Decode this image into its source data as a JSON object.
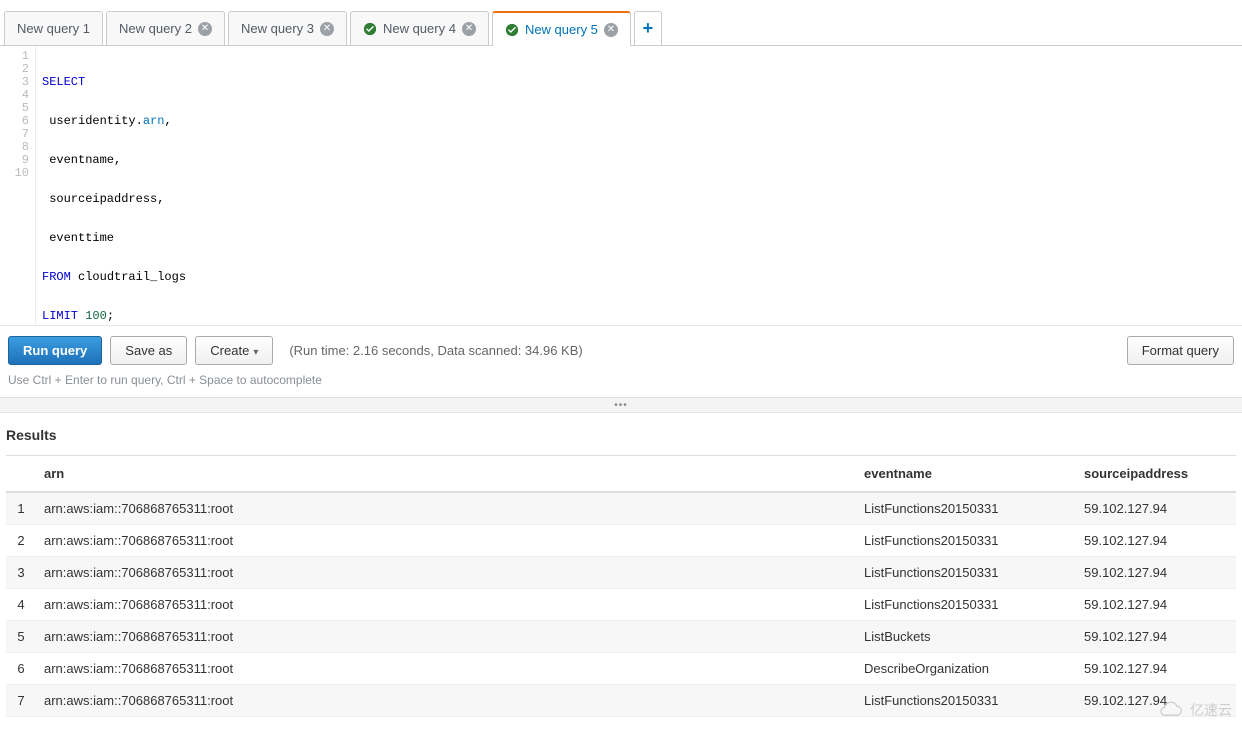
{
  "tabs": [
    {
      "label": "New query 1",
      "closable": false,
      "status": null,
      "active": false
    },
    {
      "label": "New query 2",
      "closable": true,
      "status": null,
      "active": false
    },
    {
      "label": "New query 3",
      "closable": true,
      "status": null,
      "active": false
    },
    {
      "label": "New query 4",
      "closable": true,
      "status": "success",
      "active": false
    },
    {
      "label": "New query 5",
      "closable": true,
      "status": "success",
      "active": true
    }
  ],
  "editor": {
    "line_count": 10,
    "lines": {
      "l1": {
        "kw": "SELECT"
      },
      "l2": {
        "prefix": " useridentity.",
        "fn": "arn",
        "suffix": ","
      },
      "l3": " eventname,",
      "l4": " sourceipaddress,",
      "l5": " eventtime",
      "l6": {
        "kw": "FROM",
        "rest": " cloudtrail_logs"
      },
      "l7": {
        "kw": "LIMIT ",
        "num": "100",
        "suffix": ";"
      }
    }
  },
  "actions": {
    "run": "Run query",
    "save_as": "Save as",
    "create": "Create",
    "format": "Format query",
    "run_info": "(Run time: 2.16 seconds, Data scanned: 34.96 KB)",
    "hint": "Use Ctrl + Enter to run query, Ctrl + Space to autocomplete"
  },
  "divider": "•••",
  "results": {
    "title": "Results",
    "columns": {
      "idx": "",
      "arn": "arn",
      "eventname": "eventname",
      "sourceip": "sourceipaddress"
    },
    "rows": [
      {
        "idx": "1",
        "arn": "arn:aws:iam::706868765311:root",
        "eventname": "ListFunctions20150331",
        "sourceip": "59.102.127.94"
      },
      {
        "idx": "2",
        "arn": "arn:aws:iam::706868765311:root",
        "eventname": "ListFunctions20150331",
        "sourceip": "59.102.127.94"
      },
      {
        "idx": "3",
        "arn": "arn:aws:iam::706868765311:root",
        "eventname": "ListFunctions20150331",
        "sourceip": "59.102.127.94"
      },
      {
        "idx": "4",
        "arn": "arn:aws:iam::706868765311:root",
        "eventname": "ListFunctions20150331",
        "sourceip": "59.102.127.94"
      },
      {
        "idx": "5",
        "arn": "arn:aws:iam::706868765311:root",
        "eventname": "ListBuckets",
        "sourceip": "59.102.127.94"
      },
      {
        "idx": "6",
        "arn": "arn:aws:iam::706868765311:root",
        "eventname": "DescribeOrganization",
        "sourceip": "59.102.127.94"
      },
      {
        "idx": "7",
        "arn": "arn:aws:iam::706868765311:root",
        "eventname": "ListFunctions20150331",
        "sourceip": "59.102.127.94"
      }
    ]
  },
  "watermark": "亿速云"
}
